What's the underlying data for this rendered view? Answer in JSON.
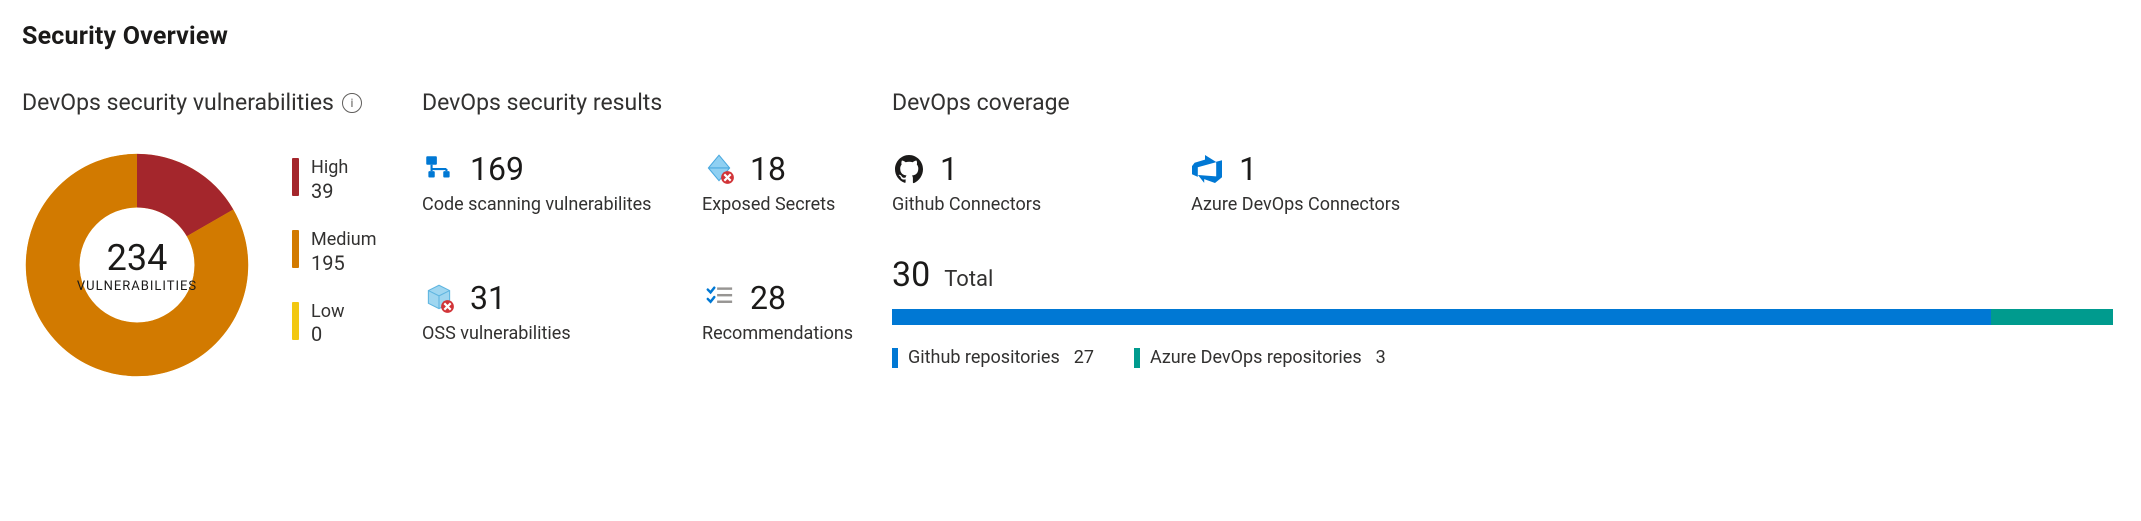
{
  "title": "Security Overview",
  "vulnerabilities": {
    "heading": "DevOps security vulnerabilities",
    "info_glyph": "i",
    "total_value": "234",
    "total_label": "VULNERABILITIES",
    "severities": [
      {
        "name": "High",
        "value": "39",
        "count": 39,
        "color": "#a4262c"
      },
      {
        "name": "Medium",
        "value": "195",
        "count": 195,
        "color": "#d27a00"
      },
      {
        "name": "Low",
        "value": "0",
        "count": 0,
        "color": "#f2c811"
      }
    ],
    "donut_track_color": "#f3b33d"
  },
  "results": {
    "heading": "DevOps security results",
    "items": [
      {
        "id": "code-scan",
        "value": "169",
        "label": "Code scanning vulnerabilites",
        "icon": "scan-icon",
        "icon_color": "#0078d4"
      },
      {
        "id": "secrets",
        "value": "18",
        "label": "Exposed Secrets",
        "icon": "secret-icon",
        "icon_color": "#6bb9e6"
      },
      {
        "id": "oss",
        "value": "31",
        "label": "OSS vulnerabilities",
        "icon": "package-icon",
        "icon_color": "#6bb9e6"
      },
      {
        "id": "recs",
        "value": "28",
        "label": "Recommendations",
        "icon": "checklist-icon",
        "icon_color": "#0078d4"
      }
    ]
  },
  "coverage": {
    "heading": "DevOps coverage",
    "connectors": [
      {
        "id": "github",
        "value": "1",
        "label": "Github Connectors",
        "icon": "github-icon",
        "icon_color": "#1b1a19"
      },
      {
        "id": "ado",
        "value": "1",
        "label": "Azure DevOps Connectors",
        "icon": "azuredevops-icon",
        "icon_color": "#0078d4"
      }
    ],
    "total_value": "30",
    "total_word": "Total",
    "breakdown": [
      {
        "name": "Github repositories",
        "value": "27",
        "count": 27,
        "color": "#0078d4"
      },
      {
        "name": "Azure DevOps repositories",
        "value": "3",
        "count": 3,
        "color": "#009b8e"
      }
    ]
  },
  "chart_data": [
    {
      "type": "pie",
      "title": "DevOps security vulnerabilities",
      "categories": [
        "High",
        "Medium",
        "Low"
      ],
      "values": [
        39,
        195,
        0
      ],
      "total": 234
    },
    {
      "type": "bar",
      "title": "DevOps coverage",
      "categories": [
        "Github repositories",
        "Azure DevOps repositories"
      ],
      "values": [
        27,
        3
      ],
      "total": 30
    }
  ],
  "colors": {
    "accent": "#0078d4",
    "teal": "#009b8e"
  }
}
